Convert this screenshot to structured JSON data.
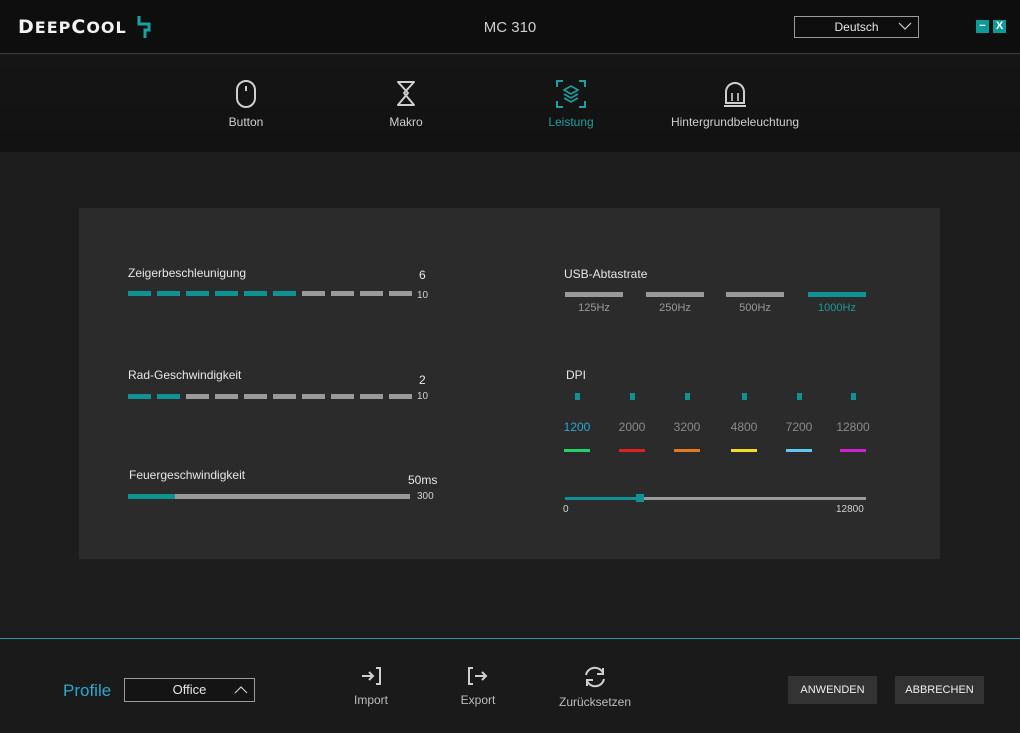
{
  "titlebar": {
    "logo_first": "D",
    "logo_mid": "EEP",
    "logo_c": "C",
    "logo_end": "OOL",
    "title": "MC 310",
    "language": "Deutsch",
    "minimize": "−",
    "close": "X"
  },
  "nav": [
    {
      "label": "Button",
      "icon": "mouse-icon"
    },
    {
      "label": "Makro",
      "icon": "macro-icon"
    },
    {
      "label": "Leistung",
      "icon": "performance-icon",
      "active": true
    },
    {
      "label": "Hintergrundbeleuchtung",
      "icon": "light-icon"
    }
  ],
  "settings": {
    "pointer": {
      "label": "Zeigerbeschleunigung",
      "value": "6",
      "max": "10",
      "level": 6,
      "segments": 10
    },
    "wheel": {
      "label": "Rad-Geschwindigkeit",
      "value": "2",
      "max": "10",
      "level": 2,
      "segments": 10
    },
    "fire": {
      "label": "Feuergeschwindigkeit",
      "value": "50ms",
      "max": "300",
      "fraction": 0.1667
    },
    "usb": {
      "label": "USB-Abtastrate",
      "rates": [
        "125Hz",
        "250Hz",
        "500Hz",
        "1000Hz"
      ],
      "selected": 3
    },
    "dpi": {
      "label": "DPI",
      "levels": [
        "1200",
        "2000",
        "3200",
        "4800",
        "7200",
        "12800"
      ],
      "colors": [
        "#22d36b",
        "#e02020",
        "#e8781e",
        "#f0e020",
        "#60c8f0",
        "#d020d0"
      ],
      "selected": 0,
      "min": "0",
      "max": "12800",
      "value": 3200
    }
  },
  "bottom": {
    "profile_label": "Profile",
    "profile_value": "Office",
    "import": "Import",
    "export": "Export",
    "reset": "Zurücksetzen",
    "apply": "ANWENDEN",
    "cancel": "ABBRECHEN"
  },
  "colors": {
    "accent": "#0f9292",
    "highlight": "#2aa7d0"
  }
}
